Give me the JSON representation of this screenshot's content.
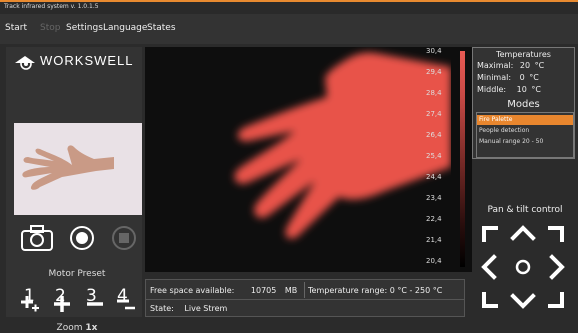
{
  "window": {
    "title": "Track infrared system  v. 1.0.1.5"
  },
  "menu": [
    {
      "label": "Start",
      "enabled": true
    },
    {
      "label": "Stop",
      "enabled": false
    },
    {
      "label": "Settings",
      "enabled": true
    },
    {
      "label": "Language",
      "enabled": true
    },
    {
      "label": "States",
      "enabled": true
    }
  ],
  "brand": {
    "logo_text": "WORKSWELL"
  },
  "motor": {
    "title": "Motor Preset",
    "presets": [
      "1",
      "2",
      "3",
      "4"
    ]
  },
  "zoom": {
    "title": "Zoom",
    "value": "1x"
  },
  "scale": {
    "labels": [
      "30,4",
      "29,4",
      "28,4",
      "27,4",
      "26,4",
      "25,4",
      "24,4",
      "23,4",
      "22,4",
      "21,4",
      "20,4"
    ],
    "top_color": "#e8524a",
    "bottom_color": "#000000"
  },
  "info": {
    "free_space_label": "Free space available:",
    "free_space_value": "10705",
    "free_space_unit": "MB",
    "temp_range": "Temperature range: 0 °C - 250 °C",
    "state_label": "State:",
    "state_value": "Live Strem"
  },
  "temperatures": {
    "title": "Temperatures",
    "maximal_label": "Maximal:",
    "maximal_value": "20",
    "minimal_label": "Minimal:",
    "minimal_value": "0",
    "middle_label": "Middle:",
    "middle_value": "10",
    "unit": "°C"
  },
  "modes": {
    "title": "Modes",
    "items": [
      "Fire Palette",
      "People detection",
      "Manual range 20 - 50"
    ],
    "selected": 0
  },
  "pan": {
    "title_a": "Pan & tilt",
    "title_b": "control"
  },
  "colors": {
    "accent": "#e8862e",
    "hand_thermal": "#e85a54"
  }
}
